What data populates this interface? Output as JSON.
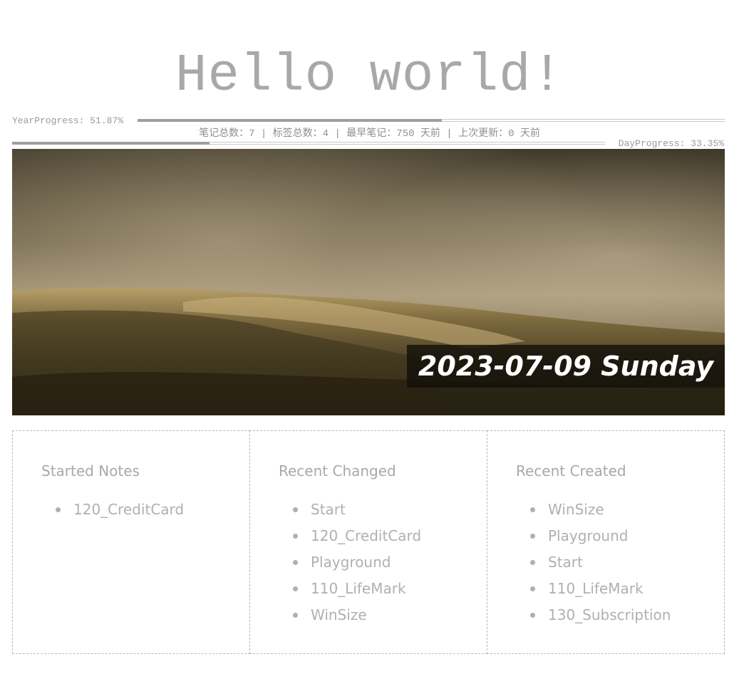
{
  "header": {
    "title": "Hello world!"
  },
  "progress": {
    "year_label": "YearProgress: 51.87%",
    "year_fraction": 0.5187,
    "day_label": "DayProgress: 33.35%",
    "day_fraction": 0.3335
  },
  "stats": {
    "text": "笔记总数：7 | 标签总数：4 | 最早笔记：750 天前 | 上次更新：0 天前"
  },
  "banner": {
    "date": "2023-07-09 Sunday"
  },
  "panels": {
    "started": {
      "title": "Started Notes",
      "items": [
        "120_CreditCard"
      ]
    },
    "changed": {
      "title": "Recent Changed",
      "items": [
        "Start",
        "120_CreditCard",
        "Playground",
        "110_LifeMark",
        "WinSize"
      ]
    },
    "created": {
      "title": "Recent Created",
      "items": [
        "WinSize",
        "Playground",
        "Start",
        "110_LifeMark",
        "130_Subscription"
      ]
    }
  }
}
